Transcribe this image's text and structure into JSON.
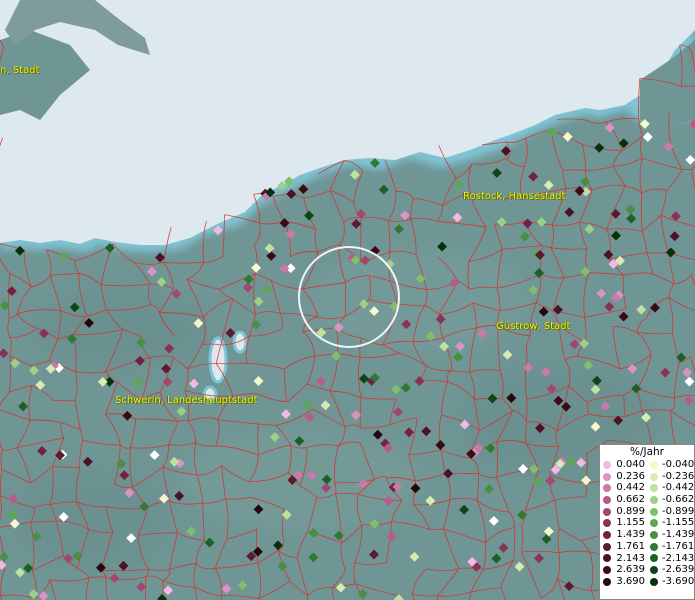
{
  "map": {
    "cities": [
      {
        "name": "Rostock, Hansestadt",
        "id": "rostock"
      },
      {
        "name": "Güstrow, Stadt",
        "id": "guestrow"
      },
      {
        "name": "Schwerin, Landeshauptstadt",
        "id": "schwerin"
      },
      {
        "name": "n, Stadt",
        "id": "west-edge-city"
      }
    ],
    "colors": {
      "sea": "#dde9ee",
      "land": "#6f9595",
      "borders": "#d8302c",
      "selection_circle": "#ffffff"
    }
  },
  "legend": {
    "title": "%/Jahr",
    "positive": [
      {
        "value": "0.040",
        "color": "#f2b8e6"
      },
      {
        "value": "0.236",
        "color": "#dd92c6"
      },
      {
        "value": "0.442",
        "color": "#c97aa8"
      },
      {
        "value": "0.662",
        "color": "#b55d88"
      },
      {
        "value": "0.899",
        "color": "#a0486f"
      },
      {
        "value": "1.155",
        "color": "#8a3256"
      },
      {
        "value": "1.439",
        "color": "#72223f"
      },
      {
        "value": "1.761",
        "color": "#5d1a2f"
      },
      {
        "value": "2.143",
        "color": "#4a1222"
      },
      {
        "value": "2.639",
        "color": "#3a0b16"
      },
      {
        "value": "3.690",
        "color": "#26050c"
      }
    ],
    "negative": [
      {
        "value": "-0.040",
        "color": "#f4f8cc"
      },
      {
        "value": "-0.236",
        "color": "#d6ebb0"
      },
      {
        "value": "-0.442",
        "color": "#bfe1a0"
      },
      {
        "value": "-0.662",
        "color": "#9ccf87"
      },
      {
        "value": "-0.899",
        "color": "#7fbf6c"
      },
      {
        "value": "-1.155",
        "color": "#5ea656"
      },
      {
        "value": "-1.439",
        "color": "#478f44"
      },
      {
        "value": "-1.761",
        "color": "#2f7a33"
      },
      {
        "value": "-2.143",
        "color": "#1c6124"
      },
      {
        "value": "-2.639",
        "color": "#0e4717"
      },
      {
        "value": "-3.690",
        "color": "#06300c"
      }
    ]
  }
}
